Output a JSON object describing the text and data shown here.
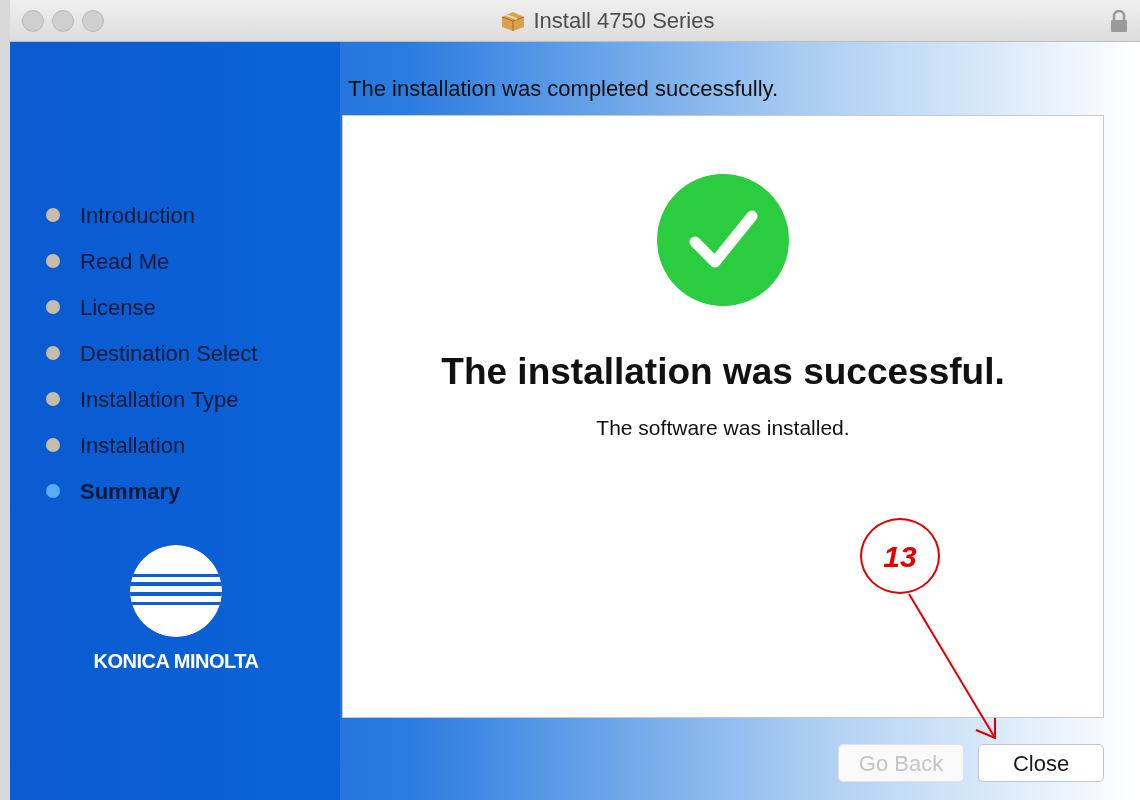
{
  "window": {
    "title": "Install 4750 Series"
  },
  "steps": [
    {
      "label": "Introduction",
      "selected": false
    },
    {
      "label": "Read Me",
      "selected": false
    },
    {
      "label": "License",
      "selected": false
    },
    {
      "label": "Destination Select",
      "selected": false
    },
    {
      "label": "Installation Type",
      "selected": false
    },
    {
      "label": "Installation",
      "selected": false
    },
    {
      "label": "Summary",
      "selected": true
    }
  ],
  "logo": {
    "text": "KONICA MINOLTA"
  },
  "header": "The installation was completed successfully.",
  "result": {
    "title": "The installation was successful.",
    "message": "The software was installed."
  },
  "buttons": [
    {
      "label": "Go Back",
      "disabled": true
    },
    {
      "label": "Close",
      "disabled": false
    }
  ],
  "annotation": {
    "number": "13"
  }
}
